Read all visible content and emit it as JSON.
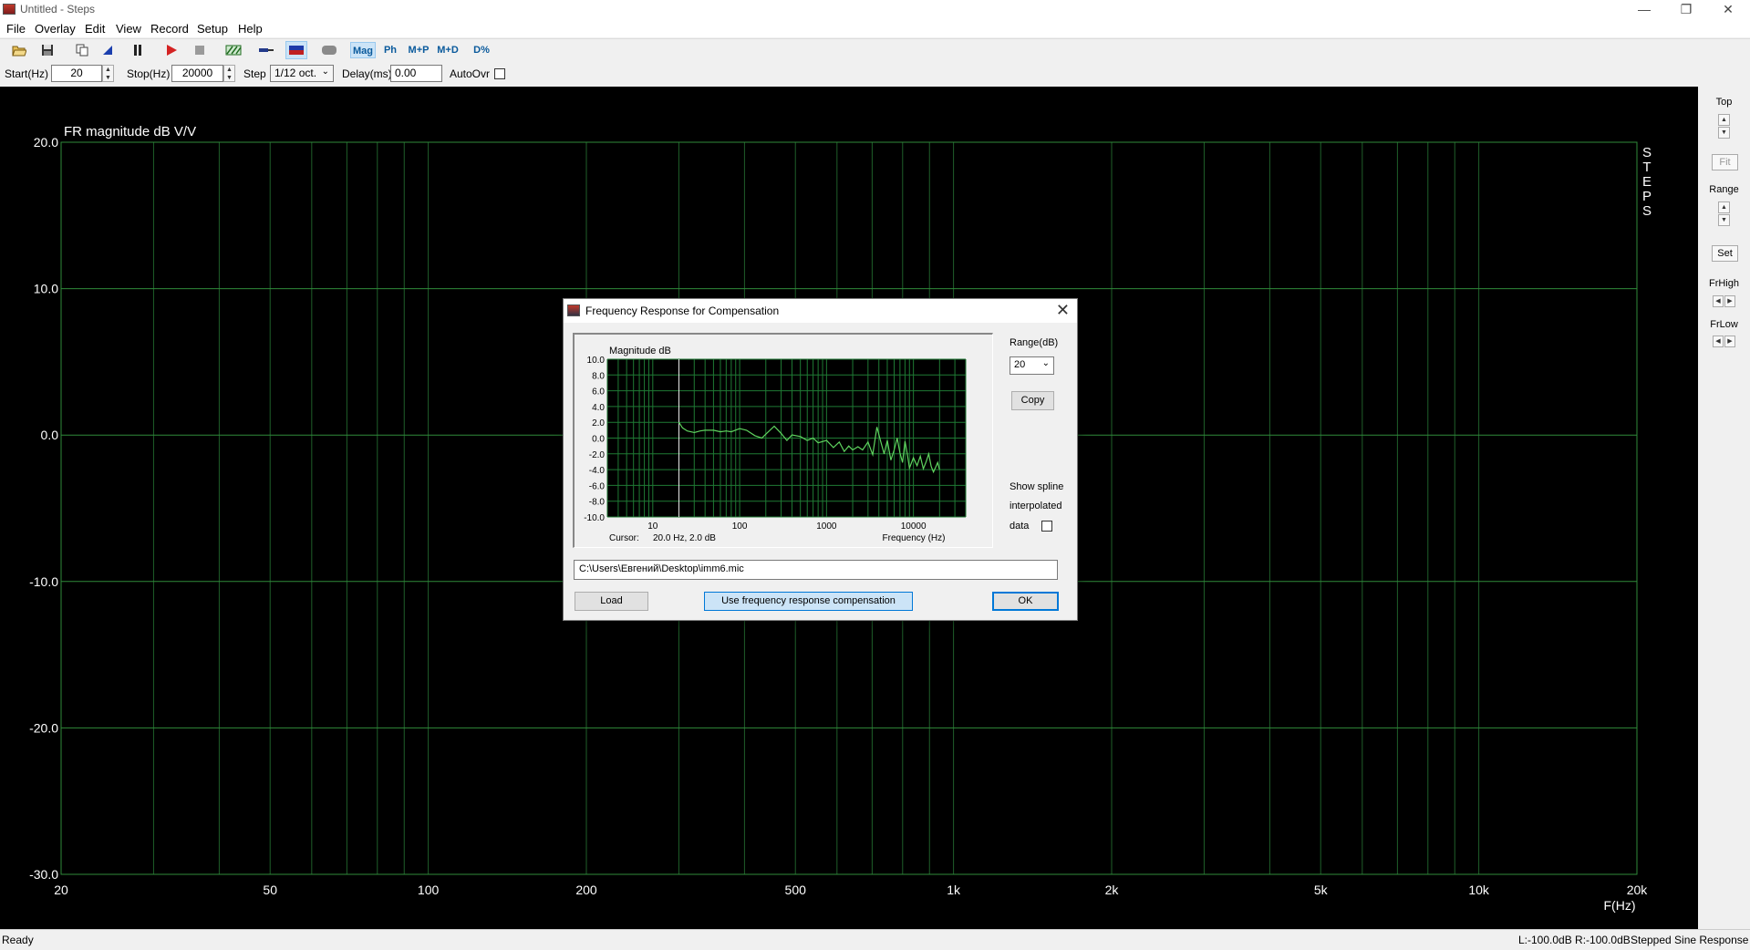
{
  "window": {
    "title": "Untitled - Steps",
    "minimize_glyph": "—",
    "restore_glyph": "❐",
    "close_glyph": "✕"
  },
  "menu": [
    "File",
    "Overlay",
    "Edit",
    "View",
    "Record",
    "Setup",
    "Help"
  ],
  "toolbar": {
    "icons": [
      "open-icon",
      "save-icon",
      "copy-icon",
      "marker-icon",
      "pause-icon",
      "play-icon",
      "stop-icon",
      "calibrate-icon",
      "probe-icon",
      "channels-icon",
      "record-toggle-icon"
    ],
    "mode_buttons": [
      "Mag",
      "Ph",
      "M+P",
      "M+D",
      "D%"
    ],
    "active_mode": "Mag"
  },
  "params": {
    "start_label": "Start(Hz)",
    "start_value": "20",
    "stop_label": "Stop(Hz)",
    "stop_value": "20000",
    "step_label": "Step",
    "step_value": "1/12 oct.",
    "delay_label": "Delay(ms)",
    "delay_value": "0.00",
    "autoovr_label": "AutoOvr",
    "autoovr_checked": false
  },
  "chart_data": [
    {
      "type": "line",
      "title": "FR magnitude dB V/V",
      "xlabel": "F(Hz)",
      "ylabel": "",
      "x_scale": "log",
      "xlim": [
        20,
        20000
      ],
      "ylim": [
        -30,
        20
      ],
      "x_tick_labels": [
        "20",
        "50",
        "100",
        "200",
        "500",
        "1k",
        "2k",
        "5k",
        "10k",
        "20k"
      ],
      "x_tick_values": [
        20,
        50,
        100,
        200,
        500,
        1000,
        2000,
        5000,
        10000,
        20000
      ],
      "y_tick_labels": [
        "20.0",
        "10.0",
        "0.0",
        "-10.0",
        "-20.0",
        "-30.0"
      ],
      "y_tick_values": [
        20,
        10,
        0,
        -10,
        -20,
        -30
      ],
      "grid": true,
      "background": "#000000",
      "grid_color": "#1f5f2a",
      "side_label": [
        "S",
        "T",
        "E",
        "P",
        "S"
      ],
      "series": []
    },
    {
      "type": "line",
      "title": "Magnitude dB",
      "xlabel": "Frequency (Hz)",
      "ylabel": "",
      "x_scale": "log",
      "xlim": [
        3,
        40000
      ],
      "ylim": [
        -10,
        10
      ],
      "x_tick_labels": [
        "10",
        "100",
        "1000",
        "10000"
      ],
      "x_tick_values": [
        10,
        100,
        1000,
        10000
      ],
      "y_tick_labels": [
        "10.0",
        "8.0",
        "6.0",
        "4.0",
        "2.0",
        "0.0",
        "-2.0",
        "-4.0",
        "-6.0",
        "-8.0",
        "-10.0"
      ],
      "y_tick_values": [
        10,
        8,
        6,
        4,
        2,
        0,
        -2,
        -4,
        -6,
        -8,
        -10
      ],
      "grid": true,
      "background": "#000000",
      "grid_color": "#1f7a34",
      "line_color": "#5fd35f",
      "cursor_x": 20,
      "cursor_label": "Cursor:",
      "cursor_value": "20.0 Hz, 2.0 dB",
      "series": [
        {
          "x": [
            20,
            22,
            25,
            30,
            35,
            40,
            50,
            60,
            70,
            80,
            100,
            120,
            150,
            180,
            200,
            250,
            300,
            350,
            400,
            500,
            600,
            700,
            800,
            1000,
            1200,
            1400,
            1600,
            1800,
            2000,
            2300,
            2600,
            3000,
            3400,
            3800,
            4200,
            4600,
            5000,
            5500,
            6000,
            6500,
            7000,
            7500,
            8000,
            8500,
            9000,
            10000,
            11000,
            12000,
            13000,
            14000,
            15000,
            16000,
            17000,
            18000,
            19000,
            20000
          ],
          "y": [
            2.0,
            1.3,
            0.9,
            0.7,
            0.9,
            1.0,
            1.0,
            0.8,
            0.9,
            0.8,
            1.2,
            1.0,
            0.3,
            0.0,
            0.5,
            1.5,
            0.6,
            -0.3,
            0.4,
            0.2,
            -0.3,
            0.0,
            -0.6,
            -0.3,
            -1.2,
            -0.5,
            -1.7,
            -1.0,
            -1.5,
            -1.1,
            -1.5,
            -0.5,
            -2.1,
            1.4,
            -0.4,
            -2.0,
            -0.3,
            -2.8,
            -1.5,
            0.0,
            -1.9,
            -3.1,
            -0.4,
            -2.0,
            -3.8,
            -2.5,
            -3.5,
            -2.3,
            -3.9,
            -3.0,
            -2.0,
            -3.6,
            -4.3,
            -3.7,
            -3.1,
            -4.0
          ]
        }
      ]
    }
  ],
  "right_panel": {
    "top_label": "Top",
    "fit_label": "Fit",
    "range_label": "Range",
    "set_label": "Set",
    "frhigh_label": "FrHigh",
    "frlow_label": "FrLow"
  },
  "dialog": {
    "title": "Frequency Response for Compensation",
    "range_label": "Range(dB)",
    "range_value": "20",
    "copy_label": "Copy",
    "spline_text_1": "Show spline",
    "spline_text_2": "interpolated",
    "spline_text_3": "data",
    "spline_checked": false,
    "file_path": "C:\\Users\\Евгений\\Desktop\\imm6.mic",
    "load_label": "Load",
    "use_comp_label": "Use frequency response compensation",
    "ok_label": "OK"
  },
  "status": {
    "left": "Ready",
    "levels": "L:-100.0dB  R:-100.0dB",
    "mode": "Stepped Sine Response"
  }
}
